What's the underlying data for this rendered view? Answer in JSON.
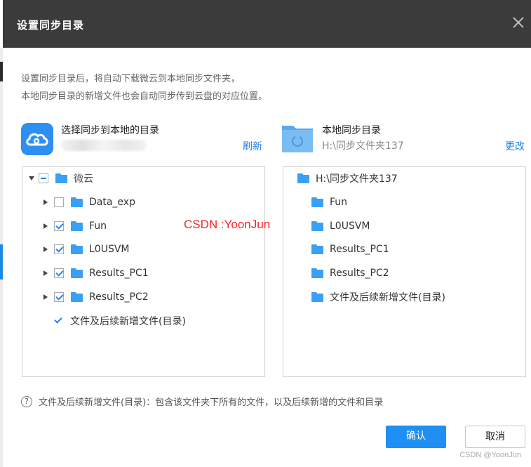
{
  "dialog": {
    "title": "设置同步目录",
    "description_line1": "设置同步目录后，将自动下载微云到本地同步文件夹，",
    "description_line2": "本地同步目录的新增文件也会自动同步传到云盘的对应位置。"
  },
  "source": {
    "title": "选择同步到本地的目录",
    "refresh_label": "刷新",
    "tree": [
      {
        "label": "微云",
        "expanded": true,
        "check": "partial",
        "level": 0
      },
      {
        "label": "Data_exp",
        "check": "unchecked",
        "level": 1
      },
      {
        "label": "Fun",
        "check": "checked",
        "level": 1
      },
      {
        "label": "L0USVM",
        "check": "checked",
        "level": 1
      },
      {
        "label": "Results_PC1",
        "check": "checked",
        "level": 1
      },
      {
        "label": "Results_PC2",
        "check": "checked",
        "level": 1
      },
      {
        "label": "文件及后续新增文件(目录)",
        "check": "checked",
        "level": 1
      }
    ]
  },
  "local": {
    "title": "本地同步目录",
    "path": "H:\\同步文件夹137",
    "change_label": "更改",
    "tree": [
      {
        "label": "H:\\同步文件夹137",
        "level": 0
      },
      {
        "label": "Fun",
        "level": 1
      },
      {
        "label": "L0USVM",
        "level": 1
      },
      {
        "label": "Results_PC1",
        "level": 1
      },
      {
        "label": "Results_PC2",
        "level": 1
      },
      {
        "label": "文件及后续新增文件(目录)",
        "level": 1
      }
    ]
  },
  "note": "文件及后续新增文件(目录)：包含该文件夹下所有的文件，以及后续新增的文件和目录",
  "buttons": {
    "confirm": "确认",
    "cancel": "取消"
  },
  "watermark": "CSDN :YoonJun",
  "footer_watermark": "CSDN @YoonJun",
  "icons": {
    "close": "close-icon",
    "source": "cloud-icon",
    "local": "local-folder-icon",
    "help": "question-icon"
  },
  "colors": {
    "titlebar": "#3b3b3c",
    "accent": "#1f8ff3",
    "link": "#1d7fe6",
    "folder": "#3aa0f5",
    "watermark": "#ff1f1f"
  }
}
